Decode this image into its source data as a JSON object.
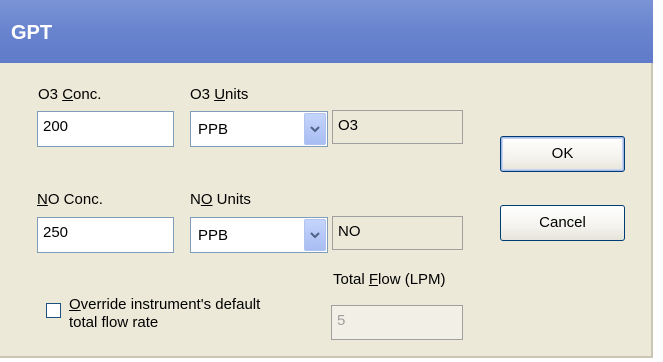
{
  "window": {
    "title": "GPT"
  },
  "o3": {
    "conc_label_pre": "O3 ",
    "conc_label_u": "C",
    "conc_label_post": "onc.",
    "conc_value": "200",
    "units_label_pre": "O3 ",
    "units_label_u": "U",
    "units_label_post": "nits",
    "units_value": "PPB",
    "species": "O3"
  },
  "no": {
    "conc_label_u": "N",
    "conc_label_post": "O Conc.",
    "conc_value": "250",
    "units_label_pre": "N",
    "units_label_u": "O",
    "units_label_post": " Units",
    "units_value": "PPB",
    "species": "NO"
  },
  "flow": {
    "label_pre": "Total ",
    "label_u": "F",
    "label_post": "low (LPM)",
    "value": "5"
  },
  "override": {
    "line1_u": "O",
    "line1_post": "verride instrument's default",
    "line2": "total flow rate",
    "checked": false
  },
  "buttons": {
    "ok": "OK",
    "cancel": "Cancel"
  }
}
